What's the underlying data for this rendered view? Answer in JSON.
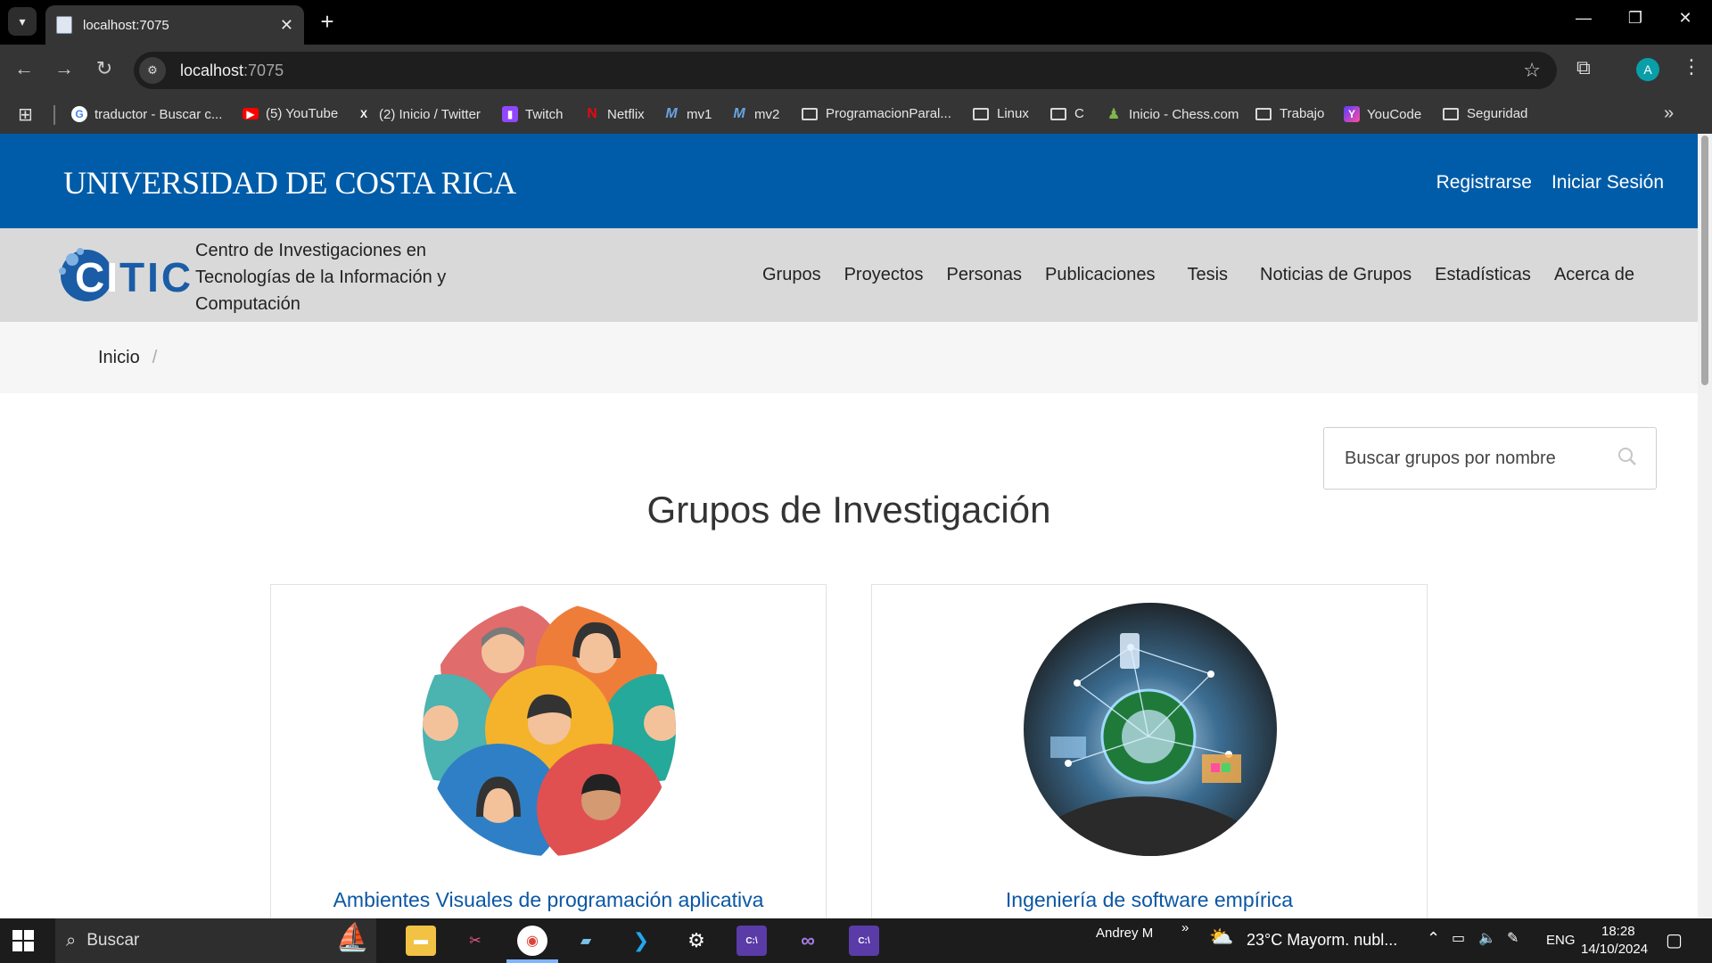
{
  "browser": {
    "tab_title": "localhost:7075",
    "url_host": "localhost",
    "url_port": ":7075",
    "bookmarks": [
      {
        "label": "traductor - Buscar c...",
        "icon": "google-icon"
      },
      {
        "label": "(5) YouTube",
        "icon": "youtube-icon"
      },
      {
        "label": "(2) Inicio / Twitter",
        "icon": "x-icon"
      },
      {
        "label": "Twitch",
        "icon": "twitch-icon"
      },
      {
        "label": "Netflix",
        "icon": "netflix-icon"
      },
      {
        "label": "mv1",
        "icon": "m-icon"
      },
      {
        "label": "mv2",
        "icon": "m-icon"
      },
      {
        "label": "ProgramacionParal...",
        "icon": "folder-icon"
      },
      {
        "label": "Linux",
        "icon": "folder-icon"
      },
      {
        "label": "C",
        "icon": "folder-icon"
      },
      {
        "label": "Inicio - Chess.com",
        "icon": "chess-icon"
      },
      {
        "label": "Trabajo",
        "icon": "folder-icon"
      },
      {
        "label": "YouCode",
        "icon": "youcode-icon"
      },
      {
        "label": "Seguridad",
        "icon": "folder-icon"
      }
    ],
    "profile_initial": "A"
  },
  "header": {
    "logo_text": "UNIVERSIDAD DE COSTA RICA",
    "register": "Registrarse",
    "login": "Iniciar Sesión"
  },
  "citic": {
    "logo": "CITIC",
    "name": "Centro de Investigaciones en Tecnologías de la Información y Computación",
    "nav": [
      "Grupos",
      "Proyectos",
      "Personas",
      "Publicaciones",
      "Tesis",
      "Noticias de Grupos",
      "Estadísticas",
      "Acerca de"
    ]
  },
  "breadcrumb": {
    "home": "Inicio",
    "separator": "/"
  },
  "search": {
    "placeholder": "Buscar grupos por nombre"
  },
  "main": {
    "title": "Grupos de Investigación",
    "groups": [
      {
        "name": "Ambientes Visuales de programación aplicativa",
        "image": "people-avatars-illustration"
      },
      {
        "name": "Ingeniería de software empírica",
        "image": "technology-globe-illustration"
      }
    ]
  },
  "taskbar": {
    "search_label": "Buscar",
    "user": "Andrey M",
    "weather": "23°C  Mayorm. nubl...",
    "lang": "ENG",
    "time": "18:28",
    "date": "14/10/2024"
  },
  "colors": {
    "ucr_blue": "#005ca8",
    "link_blue": "#0b57a4",
    "nav_gray": "#d9d9d9"
  }
}
